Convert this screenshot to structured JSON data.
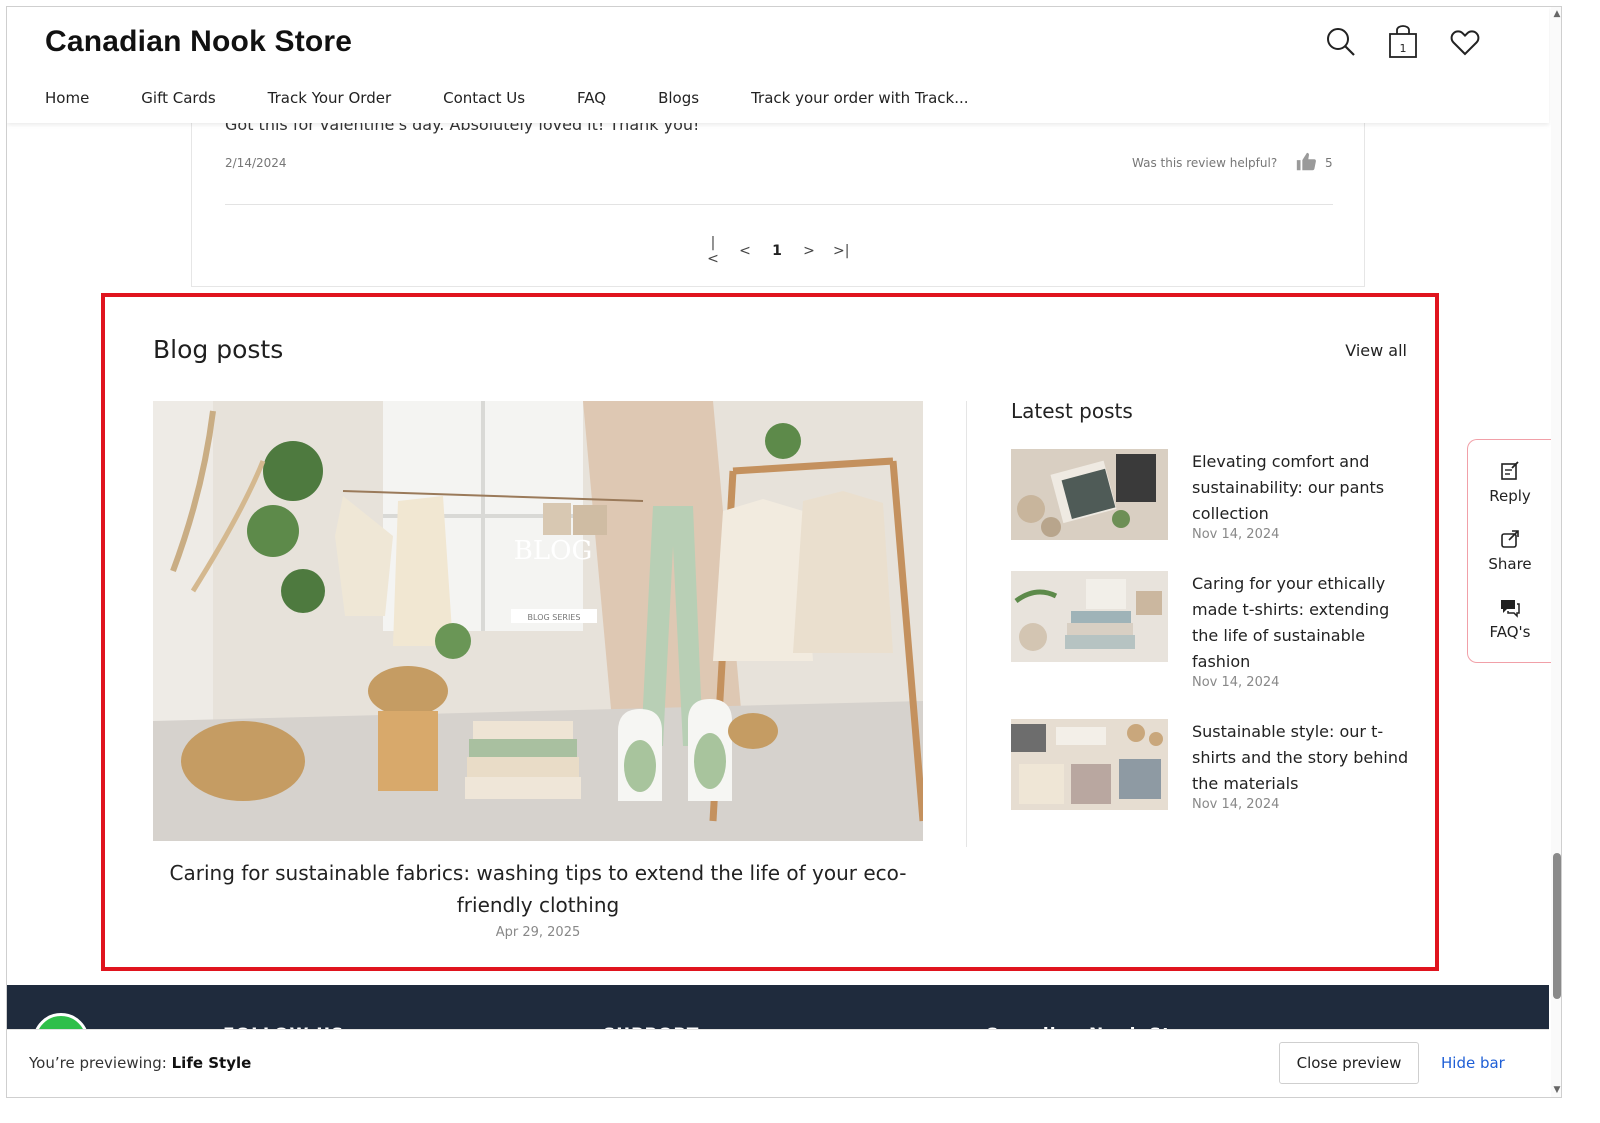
{
  "header": {
    "store_name": "Canadian Nook Store",
    "cart_count": "1",
    "nav": [
      "Home",
      "Gift Cards",
      "Track Your Order",
      "Contact Us",
      "FAQ",
      "Blogs",
      "Track your order with Track..."
    ]
  },
  "review": {
    "text": "Got this for valentine's day. Absolutely loved it! Thank you!",
    "date": "2/14/2024",
    "helpful_label": "Was this review helpful?",
    "helpful_count": "5",
    "pager": {
      "first": "|<",
      "prev": "<",
      "page": "1",
      "next": ">",
      "last": ">|"
    }
  },
  "blog": {
    "title": "Blog posts",
    "view_all": "View all",
    "featured": {
      "title": "Caring for sustainable fabrics: washing tips to extend the life of your eco-friendly clothing",
      "date": "Apr 29, 2025",
      "image_text": "BLOG",
      "image_tag": "BLOG SERIES"
    },
    "latest_title": "Latest posts",
    "latest": [
      {
        "title": "Elevating comfort and sustainability: our pants collection",
        "date": "Nov 14, 2024"
      },
      {
        "title": "Caring for your ethically made t-shirts: extending the life of sustainable fashion",
        "date": "Nov 14, 2024"
      },
      {
        "title": "Sustainable style: our t-shirts and the story behind the materials",
        "date": "Nov 14, 2024"
      }
    ]
  },
  "widget": {
    "reply": "Reply",
    "share": "Share",
    "faqs": "FAQ's"
  },
  "footer": {
    "col1": "FOLLOW US",
    "col2": "SUPPORT",
    "col3": "Canadian Nook Store"
  },
  "preview_bar": {
    "prefix": "You’re previewing:",
    "theme": "Life Style",
    "close": "Close preview",
    "hide": "Hide bar"
  },
  "colors": {
    "accent_red": "#e0141e",
    "footer_bg": "#1f2b3d",
    "link_blue": "#1f5fd6",
    "whatsapp_green": "#2fbf4a"
  }
}
